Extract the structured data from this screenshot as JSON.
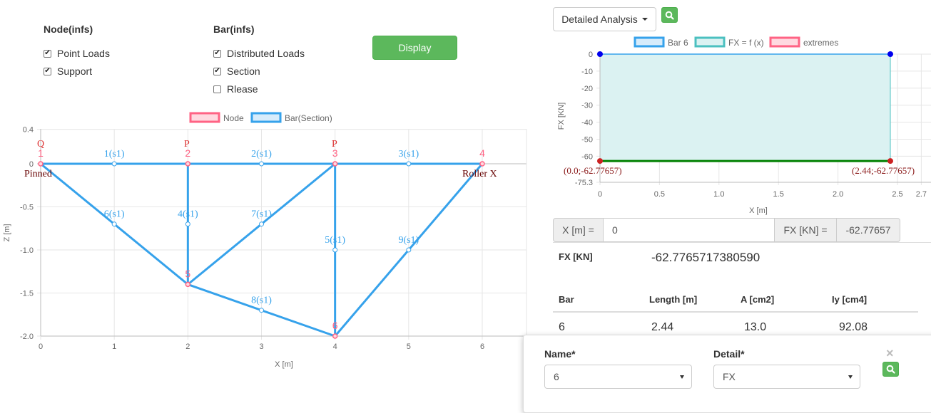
{
  "controls": {
    "node_header": "Node(infs)",
    "bar_header": "Bar(infs)",
    "node_options": [
      {
        "label": "Point Loads",
        "checked": true
      },
      {
        "label": "Support",
        "checked": true
      }
    ],
    "bar_options": [
      {
        "label": "Distributed Loads",
        "checked": true
      },
      {
        "label": "Section",
        "checked": true
      },
      {
        "label": "Rlease",
        "checked": false
      }
    ],
    "display_button": "Display"
  },
  "left_chart": {
    "legend": [
      {
        "label": "Node",
        "color": "#ff6384",
        "fill": "#ffd9e0"
      },
      {
        "label": "Bar(Section)",
        "color": "#36a2eb",
        "fill": "#d7ecfb"
      }
    ],
    "xlabel": "X [m]",
    "ylabel": "Z [m]",
    "x_ticks": [
      "0",
      "1",
      "2",
      "3",
      "4",
      "5",
      "6"
    ],
    "y_ticks": [
      "0.4",
      "0",
      "-0.5",
      "-1.0",
      "-1.5",
      "-2.0"
    ],
    "support_labels": [
      "Pinned",
      "Roller X"
    ],
    "load_labels": [
      "Q",
      "P",
      "P"
    ]
  },
  "chart_data": [
    {
      "type": "scatter",
      "title": "",
      "xlabel": "X [m]",
      "ylabel": "Z [m]",
      "xlim": [
        0,
        6.5
      ],
      "ylim": [
        -2.0,
        0.4
      ],
      "nodes": [
        {
          "label": "1",
          "x": 0,
          "y": 0
        },
        {
          "label": "2",
          "x": 2,
          "y": 0
        },
        {
          "label": "3",
          "x": 4,
          "y": 0
        },
        {
          "label": "4",
          "x": 6,
          "y": 0
        },
        {
          "label": "5",
          "x": 2,
          "y": -1.4
        },
        {
          "label": "6",
          "x": 4,
          "y": -2.0
        }
      ],
      "bars": [
        {
          "label": "1(s1)",
          "from": "1",
          "to": "2",
          "mid": [
            1,
            0
          ]
        },
        {
          "label": "2(s1)",
          "from": "2",
          "to": "3",
          "mid": [
            3,
            0
          ]
        },
        {
          "label": "3(s1)",
          "from": "3",
          "to": "4",
          "mid": [
            5,
            0
          ]
        },
        {
          "label": "4(s1)",
          "from": "2",
          "to": "5",
          "mid": [
            2,
            -0.7
          ]
        },
        {
          "label": "5(s1)",
          "from": "3",
          "to": "6",
          "mid": [
            4,
            -1.0
          ]
        },
        {
          "label": "6(s1)",
          "from": "1",
          "to": "5",
          "mid": [
            1,
            -0.7
          ]
        },
        {
          "label": "7(s1)",
          "from": "5",
          "to": "3",
          "mid": [
            3,
            -0.7
          ]
        },
        {
          "label": "8(s1)",
          "from": "5",
          "to": "6",
          "mid": [
            3,
            -1.7
          ]
        },
        {
          "label": "9(s1)",
          "from": "6",
          "to": "4",
          "mid": [
            5,
            -1.0
          ]
        }
      ]
    },
    {
      "type": "area",
      "title": "",
      "xlabel": "X [m]",
      "ylabel": "FX [KN]",
      "xlim": [
        0,
        2.7
      ],
      "ylim": [
        -75.3,
        0
      ],
      "series": [
        {
          "name": "Bar 6",
          "x": [
            0,
            2.44
          ],
          "y": [
            0,
            0
          ]
        },
        {
          "name": "FX = f (x)",
          "x": [
            0,
            2.44
          ],
          "y": [
            -62.77657,
            -62.77657
          ]
        },
        {
          "name": "extremes",
          "x": [
            0,
            2.44
          ],
          "y": [
            -62.77657,
            -62.77657
          ]
        }
      ],
      "x_ticks": [
        "0",
        "0.5",
        "1.0",
        "1.5",
        "2.0",
        "2.5",
        "2.7"
      ],
      "y_ticks": [
        "0",
        "-10",
        "-20",
        "-30",
        "-40",
        "-50",
        "-60",
        "-75.3"
      ],
      "annotations": [
        "(0.0;-62.77657)",
        "(2.44;-62.77657)"
      ]
    }
  ],
  "analysis": {
    "dropdown_label": "Detailed Analysis",
    "legend": [
      {
        "label": "Bar 6",
        "color": "#36a2eb",
        "fill": "#d7ecfb"
      },
      {
        "label": "FX = f (x)",
        "color": "#4bc0c0",
        "fill": "#dbf2f2"
      },
      {
        "label": "extremes",
        "color": "#ff6384",
        "fill": "#ffd9e0"
      }
    ],
    "x_input_label": "X [m] =",
    "x_input_value": "0",
    "fx_label": "FX [KN] =",
    "fx_value": "-62.77657",
    "result_label": "FX [KN]",
    "result_value": "-62.7765717380590",
    "table": {
      "headers": [
        "Bar",
        "Length [m]",
        "A [cm2]",
        "Iy [cm4]"
      ],
      "rows": [
        [
          "6",
          "2.44",
          "13.0",
          "92.08"
        ]
      ]
    }
  },
  "popup": {
    "name_label": "Name*",
    "name_value": "6",
    "detail_label": "Detail*",
    "detail_value": "FX",
    "close_glyph": "×"
  },
  "colors": {
    "green": "#5cb85c",
    "node": "#ff6384",
    "bar": "#36a2eb",
    "fill": "#dbf2f2",
    "line": "#008000"
  }
}
